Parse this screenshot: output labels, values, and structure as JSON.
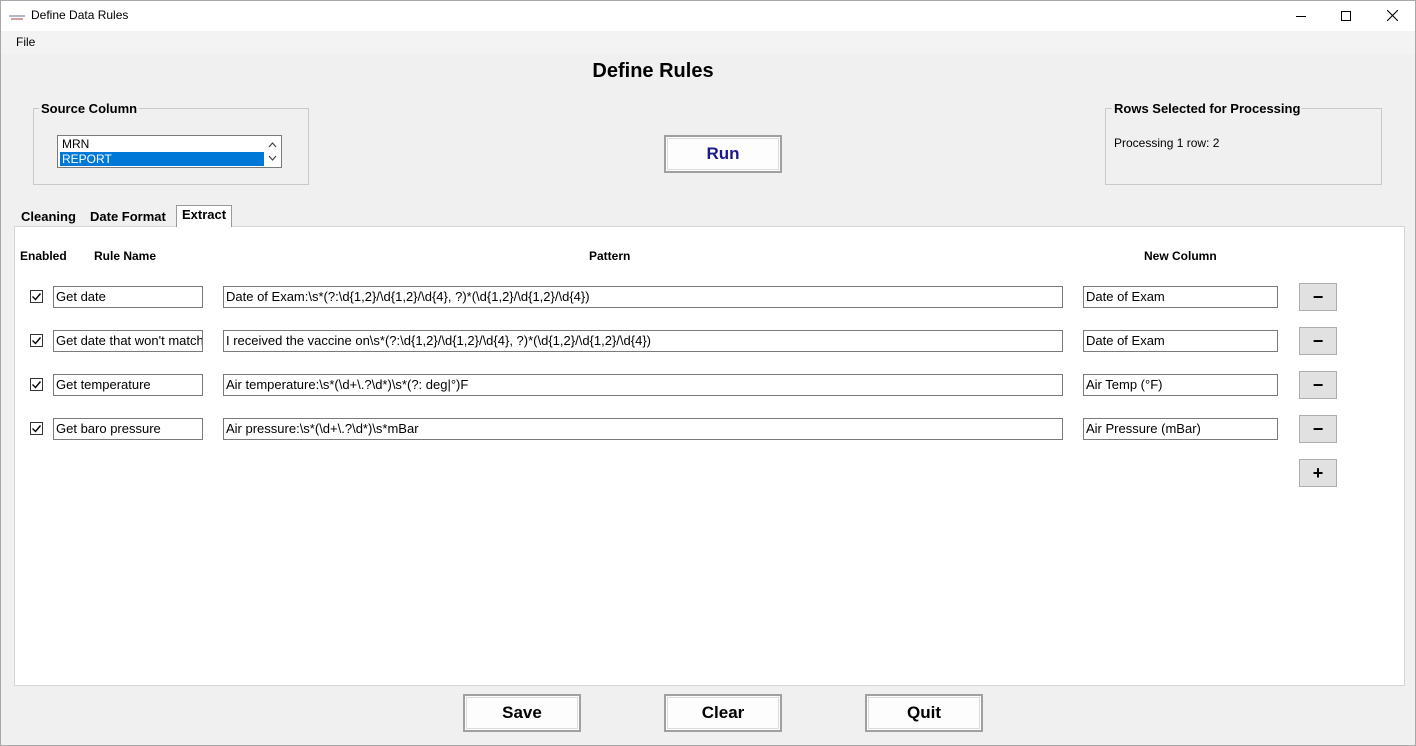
{
  "window": {
    "title": "Define Data Rules"
  },
  "menu": {
    "file": "File"
  },
  "page": {
    "title": "Define Rules"
  },
  "source_column": {
    "legend": "Source Column",
    "items": [
      "MRN",
      "REPORT"
    ],
    "selected": "REPORT"
  },
  "run_button": "Run",
  "rows_selected": {
    "legend": "Rows Selected for Processing",
    "text": "Processing 1 row: 2"
  },
  "tabs": [
    {
      "label": "Cleaning",
      "active": false
    },
    {
      "label": "Date Format",
      "active": false
    },
    {
      "label": "Extract",
      "active": true
    }
  ],
  "table": {
    "headers": {
      "enabled": "Enabled",
      "rule_name": "Rule Name",
      "pattern": "Pattern",
      "new_column": "New Column"
    },
    "rows": [
      {
        "enabled": true,
        "rule_name": "Get date",
        "pattern": "Date of Exam:\\s*(?:\\d{1,2}/\\d{1,2}/\\d{4}, ?)*(\\d{1,2}/\\d{1,2}/\\d{4})",
        "new_column": "Date of Exam",
        "remove": "−"
      },
      {
        "enabled": true,
        "rule_name": "Get date that won't match",
        "pattern": "I received the vaccine on\\s*(?:\\d{1,2}/\\d{1,2}/\\d{4}, ?)*(\\d{1,2}/\\d{1,2}/\\d{4})",
        "new_column": "Date of Exam",
        "remove": "−"
      },
      {
        "enabled": true,
        "rule_name": "Get temperature",
        "pattern": "Air temperature:\\s*(\\d+\\.?\\d*)\\s*(?: deg|°)F",
        "new_column": "Air Temp (°F)",
        "remove": "−"
      },
      {
        "enabled": true,
        "rule_name": "Get baro pressure",
        "pattern": "Air pressure:\\s*(\\d+\\.?\\d*)\\s*mBar",
        "new_column": "Air Pressure (mBar)",
        "remove": "−"
      }
    ],
    "add": "+"
  },
  "buttons": {
    "save": "Save",
    "clear": "Clear",
    "quit": "Quit"
  }
}
